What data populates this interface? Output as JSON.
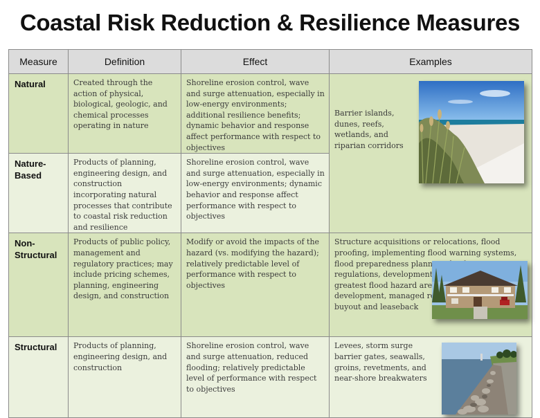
{
  "title": "Coastal Risk Reduction & Resilience Measures",
  "table": {
    "headers": [
      "Measure",
      "Definition",
      "Effect",
      "Examples"
    ],
    "rows": [
      {
        "measure": "Natural",
        "definition": "Created through the action of physical, biological, geologic, and chemical processes operating in nature",
        "effect": "Shoreline erosion control, wave and surge attenuation, especially in low-energy environments; additional resilience benefits; dynamic behavior and response affect performance with respect to objectives"
      },
      {
        "measure": "Nature-Based",
        "definition": "Products of planning, engineering design, and construction incorporating natural processes that contribute to coastal risk reduction and resilience",
        "effect": "Shoreline erosion control, wave and surge attenuation, especially in low-energy environments; dynamic behavior and response affect performance with respect to objectives"
      },
      {
        "measure": "Non-Structural",
        "definition": "Products of public policy, management and regulatory practices; may include pricing schemes, planning, engineering design, and construction",
        "effect": "Modify or avoid the impacts of the hazard (vs. modifying the hazard); relatively predictable level of performance with respect to objectives"
      },
      {
        "measure": "Structural",
        "definition": "Products of planning, engineering design, and construction",
        "effect": "Shoreline erosion control, wave and surge attenuation, reduced flooding; relatively predictable level of performance with respect to objectives"
      }
    ],
    "examples": {
      "natural_and_nature_based": "Barrier islands, dunes, reefs, wetlands, and riparian corridors",
      "non_structural": "Structure acquisitions or relocations, flood proofing, implementing flood warning systems, flood preparedness planning, land use regulations, development restrictions within the greatest flood hazard areas, elevated development, managed retreat, evacuation, buyout and leaseback",
      "structural": "Levees, storm surge barrier gates, seawalls, groins, revetments, and near-shore breakwaters"
    },
    "photos": {
      "beach": "beach-dune-photo",
      "house": "elevated-house-photo",
      "revetment": "rock-revetment-photo"
    }
  }
}
